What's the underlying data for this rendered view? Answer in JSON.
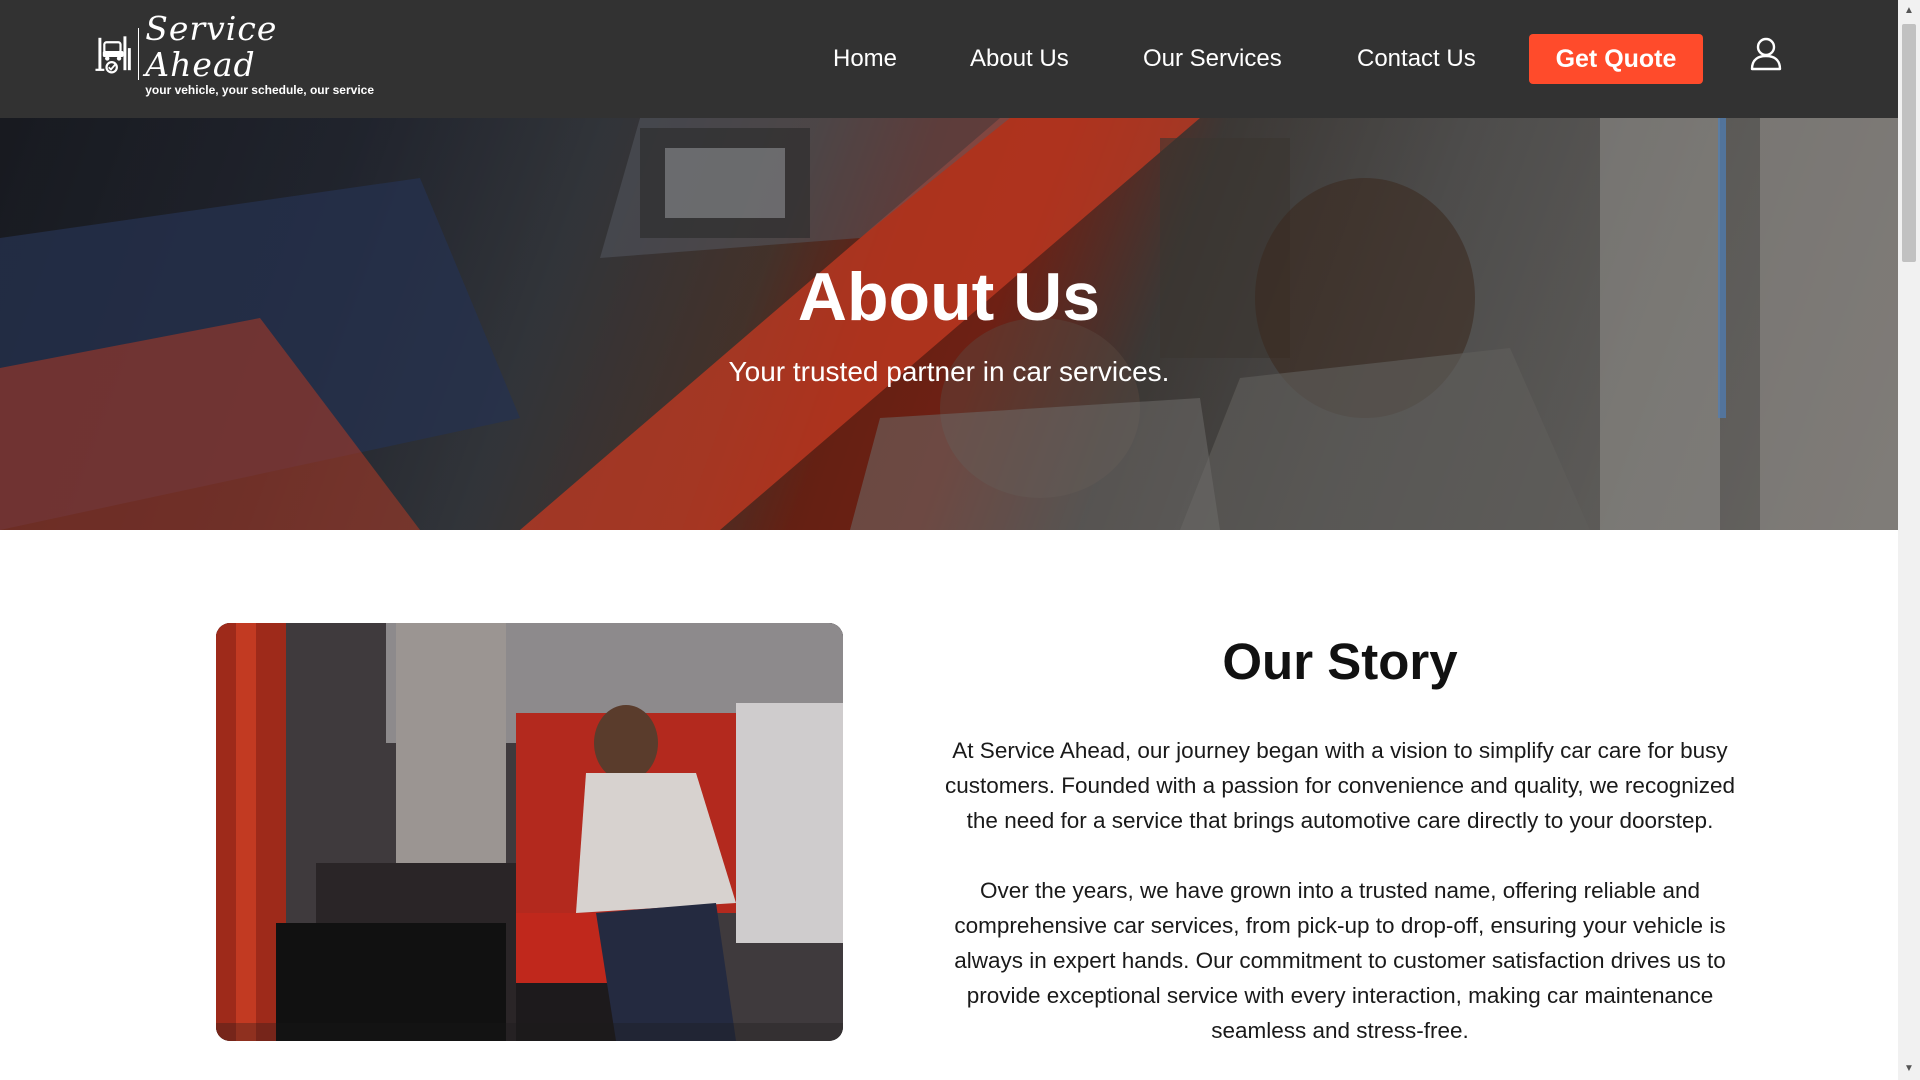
{
  "header": {
    "logo": {
      "name": "Service Ahead",
      "tagline": "your vehicle, your schedule, our service"
    },
    "nav": [
      {
        "label": "Home"
      },
      {
        "label": "About Us"
      },
      {
        "label": "Our Services"
      },
      {
        "label": "Contact Us"
      }
    ],
    "cta_label": "Get Quote",
    "user_icon": "user-icon"
  },
  "hero": {
    "title": "About Us",
    "subtitle": "Your trusted partner in car services."
  },
  "story": {
    "title": "Our Story",
    "paragraphs": [
      "At Service Ahead, our journey began with a vision to simplify car care for busy customers. Founded with a passion for convenience and quality, we recognized the need for a service that brings automotive care directly to your doorstep.",
      "Over the years, we have grown into a trusted name, offering reliable and comprehensive car services, from pick-up to drop-off, ensuring your vehicle is always in expert hands. Our commitment to customer satisfaction drives us to provide exceptional service with every interaction, making car maintenance seamless and stress-free."
    ]
  },
  "colors": {
    "header_bg": "#323232",
    "accent": "#ff4b2b",
    "text": "#111111"
  }
}
